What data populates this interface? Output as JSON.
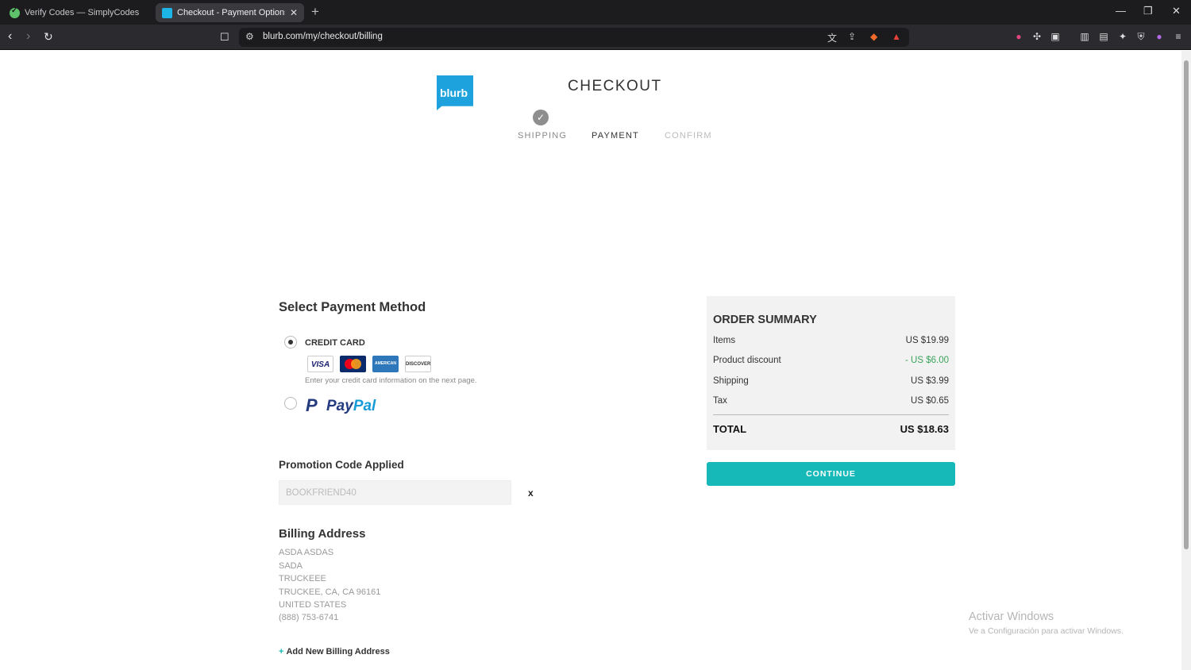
{
  "browser": {
    "tabs": [
      {
        "title": "Verify Codes — SimplyCodes",
        "active": false
      },
      {
        "title": "Checkout - Payment Options | Bl",
        "active": true
      }
    ],
    "url": "blurb.com/my/checkout/billing"
  },
  "header": {
    "logo_text": "blurb",
    "title": "CHECKOUT",
    "steps": [
      {
        "label": "SHIPPING",
        "state": "done"
      },
      {
        "label": "PAYMENT",
        "state": "current"
      },
      {
        "label": "CONFIRM",
        "state": "upcoming"
      }
    ]
  },
  "payment": {
    "heading": "Select Payment Method",
    "credit_card": {
      "label": "CREDIT CARD",
      "selected": true,
      "cards": [
        "VISA",
        "MasterCard",
        "AMERICAN EXPRESS",
        "DISCOVER"
      ],
      "note": "Enter your credit card information on the next page."
    },
    "paypal": {
      "label_a": "Pay",
      "label_b": "Pal",
      "selected": false
    }
  },
  "promo": {
    "heading": "Promotion Code Applied",
    "code": "BOOKFRIEND40",
    "remove_label": "x"
  },
  "billing": {
    "heading": "Billing Address",
    "lines": [
      "ASDA ASDAS",
      "SADA",
      "TRUCKEEE",
      "TRUCKEE, CA, CA 96161",
      "UNITED STATES",
      "(888) 753-6741"
    ],
    "add_label": "Add New Billing Address"
  },
  "summary": {
    "title": "ORDER SUMMARY",
    "rows": [
      {
        "label": "Items",
        "value": "US $19.99"
      },
      {
        "label": "Product discount",
        "value": "- US $6.00"
      },
      {
        "label": "Shipping",
        "value": "US $3.99"
      },
      {
        "label": "Tax",
        "value": "US $0.65"
      }
    ],
    "total_label": "TOTAL",
    "total_value": "US $18.63",
    "continue_label": "CONTINUE"
  },
  "watermark": {
    "line1": "Activar Windows",
    "line2": "Ve a Configuración para activar Windows."
  },
  "colors": {
    "accent": "#17b8b8",
    "brand": "#1ea2dd",
    "discount": "#3aa35a"
  }
}
